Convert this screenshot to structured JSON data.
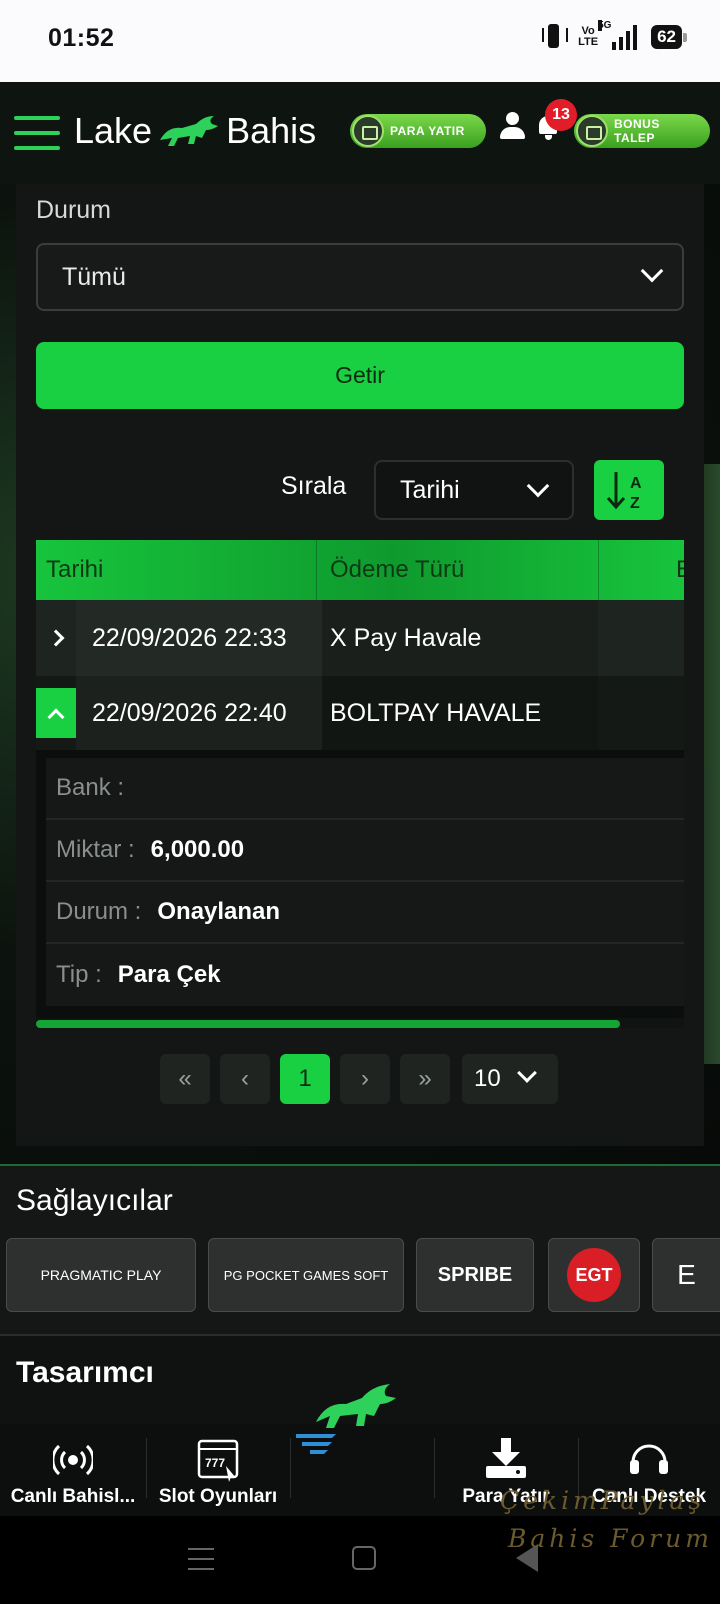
{
  "status_bar": {
    "time": "01:52",
    "network": "5G",
    "volte": "Vo LTE",
    "battery": "62"
  },
  "header": {
    "logo_left": "Lake",
    "logo_right": "Bahis",
    "deposit_button": "PARA YATIR",
    "notification_count": "13",
    "bonus_button": "BONUS TALEP"
  },
  "filter": {
    "status_label": "Durum",
    "status_value": "Tümü",
    "fetch_button": "Getir",
    "sort_label": "Sırala",
    "sort_value": "Tarihi",
    "sort_icon_top": "A",
    "sort_icon_bottom": "Z"
  },
  "table": {
    "headers": [
      "Tarihi",
      "Ödeme Türü",
      "E"
    ],
    "rows": [
      {
        "date": "22/09/2026 22:33",
        "payment_type": "X Pay Havale",
        "expanded": false
      },
      {
        "date": "22/09/2026 22:40",
        "payment_type": "BOLTPAY HAVALE",
        "expanded": true
      }
    ],
    "details": [
      {
        "key": "Bank :",
        "value": ""
      },
      {
        "key": "Miktar :",
        "value": "6,000.00"
      },
      {
        "key": "Durum :",
        "value": "Onaylanan"
      },
      {
        "key": "Tip :",
        "value": "Para Çek"
      }
    ]
  },
  "pagination": {
    "first": "«",
    "prev": "‹",
    "current": "1",
    "next": "›",
    "last": "»",
    "page_size": "10"
  },
  "providers": {
    "title": "Sağlayıcılar",
    "items": [
      "PRAGMATIC PLAY",
      "PG POCKET GAMES SOFT",
      "SPRIBE",
      "EGT",
      "E"
    ]
  },
  "designer": {
    "title": "Tasarımcı"
  },
  "bottom_nav": [
    {
      "label": "Canlı Bahisl...",
      "icon": "live-broadcast-icon"
    },
    {
      "label": "Slot Oyunları",
      "icon": "slot-machine-icon"
    },
    {
      "label": "",
      "icon": "logo-bull-icon"
    },
    {
      "label": "Para Yatır",
      "icon": "download-icon"
    },
    {
      "label": "Canlı Destek",
      "icon": "headset-icon"
    }
  ],
  "watermark": {
    "line1": "ÇekimPaylaş",
    "line2": "Bahis Forum"
  },
  "colors": {
    "accent": "#19d043",
    "background": "#0b0f0c",
    "panel": "#131614",
    "badge": "#e11d2a"
  }
}
